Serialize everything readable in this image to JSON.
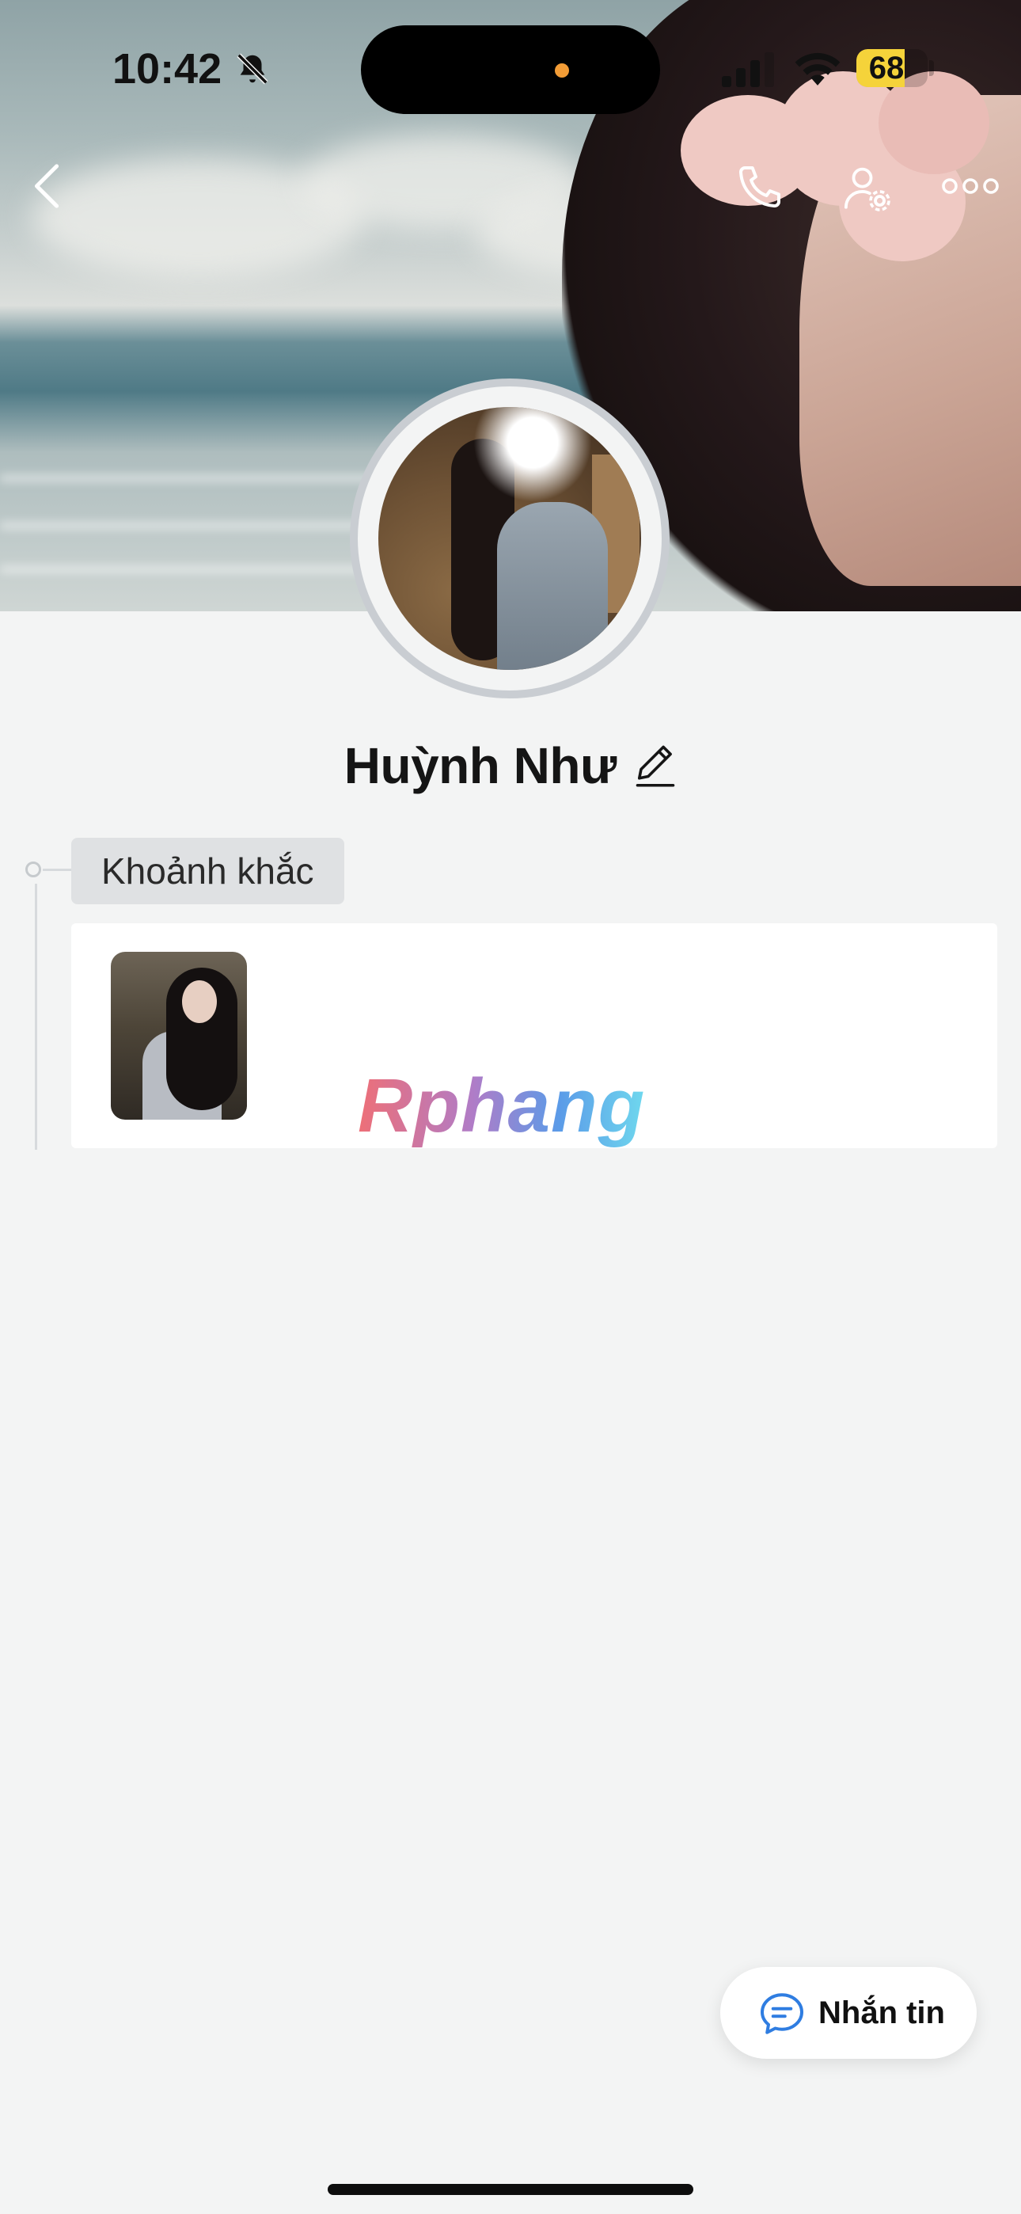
{
  "status_bar": {
    "time": "10:42",
    "battery_level": "68",
    "battery_fraction": 0.68,
    "silent_mode": true
  },
  "header_actions": {
    "back_icon": "chevron-left-icon",
    "call_icon": "phone-icon",
    "settings_icon": "user-settings-icon",
    "more_icon": "more-horizontal-icon"
  },
  "profile": {
    "name": "Huỳnh Như",
    "edit_icon": "pencil-icon"
  },
  "moments": {
    "section_label": "Khoảnh khắc",
    "watermark": "Rphang"
  },
  "actions": {
    "message_label": "Nhắn tin",
    "message_icon": "chat-bubble-icon"
  },
  "colors": {
    "background": "#f3f4f4",
    "accent_blue": "#2f7de1",
    "battery_yellow": "#f5d33a"
  }
}
